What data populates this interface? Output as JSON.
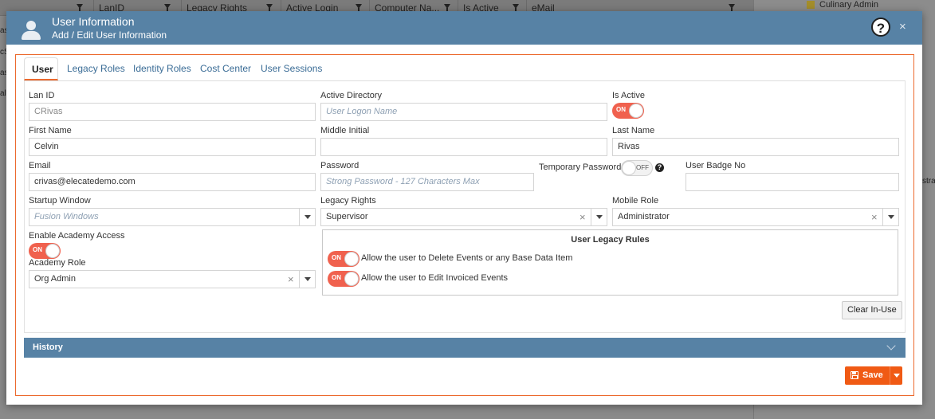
{
  "background": {
    "columns": [
      "LanID",
      "Legacy Rights",
      "Active Login",
      "Computer Na...",
      "Is Active",
      "eMail"
    ],
    "right_panel_item": "Culinary Admin",
    "left_fragments": [
      "as",
      "cS",
      "as",
      "alt"
    ],
    "right_fragment": "stra"
  },
  "modal": {
    "title": "User Information",
    "subtitle": "Add / Edit User Information",
    "help_label": "?",
    "close_label": "×"
  },
  "tabs": [
    "User",
    "Legacy Roles",
    "Identity Roles",
    "Cost Center",
    "User Sessions"
  ],
  "form": {
    "lan_id": {
      "label": "Lan ID",
      "value": "CRivas"
    },
    "active_directory": {
      "label": "Active Directory",
      "placeholder": "User Logon Name"
    },
    "is_active": {
      "label": "Is Active",
      "state": "ON"
    },
    "first_name": {
      "label": "First Name",
      "value": "Celvin"
    },
    "middle_initial": {
      "label": "Middle Initial",
      "value": ""
    },
    "last_name": {
      "label": "Last Name",
      "value": "Rivas"
    },
    "email": {
      "label": "Email",
      "value": "crivas@elecatedemo.com"
    },
    "password": {
      "label": "Password",
      "placeholder": "Strong Password - 127 Characters Max"
    },
    "temporary_password": {
      "label": "Temporary Password",
      "state": "OFF"
    },
    "user_badge_no": {
      "label": "User Badge No",
      "value": ""
    },
    "startup_window": {
      "label": "Startup Window",
      "placeholder": "Fusion Windows"
    },
    "legacy_rights": {
      "label": "Legacy Rights",
      "value": "Supervisor"
    },
    "mobile_role": {
      "label": "Mobile Role",
      "value": "Administrator"
    },
    "enable_academy_access": {
      "label": "Enable Academy Access",
      "state": "ON"
    },
    "academy_role": {
      "label": "Academy Role",
      "value": "Org Admin"
    }
  },
  "legacy_rules": {
    "title": "User Legacy Rules",
    "rules": [
      {
        "state": "ON",
        "text": "Allow the user to Delete Events or any Base Data Item"
      },
      {
        "state": "ON",
        "text": "Allow the user to Edit Invoiced Events"
      }
    ]
  },
  "clear_in_use_label": "Clear In-Use",
  "history_label": "History",
  "save_label": "Save",
  "clear_symbol": "×",
  "colors": {
    "header": "#5782a5",
    "accent": "#ec6a2e",
    "toggle_on": "#f0614e",
    "save": "#f05a14"
  }
}
